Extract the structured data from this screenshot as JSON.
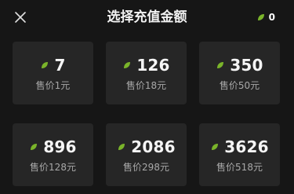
{
  "header": {
    "close_icon": "close-icon",
    "title": "选择充值金额",
    "balance_icon": "leaf-coin-icon",
    "balance_value": "0"
  },
  "colors": {
    "background": "#161616",
    "card": "#262626",
    "leaf": "#7ab42a",
    "price_text": "#a8a8a8"
  },
  "options": [
    {
      "amount": "7",
      "price": "售价1元"
    },
    {
      "amount": "126",
      "price": "售价18元"
    },
    {
      "amount": "350",
      "price": "售价50元"
    },
    {
      "amount": "896",
      "price": "售价128元"
    },
    {
      "amount": "2086",
      "price": "售价298元"
    },
    {
      "amount": "3626",
      "price": "售价518元"
    }
  ]
}
